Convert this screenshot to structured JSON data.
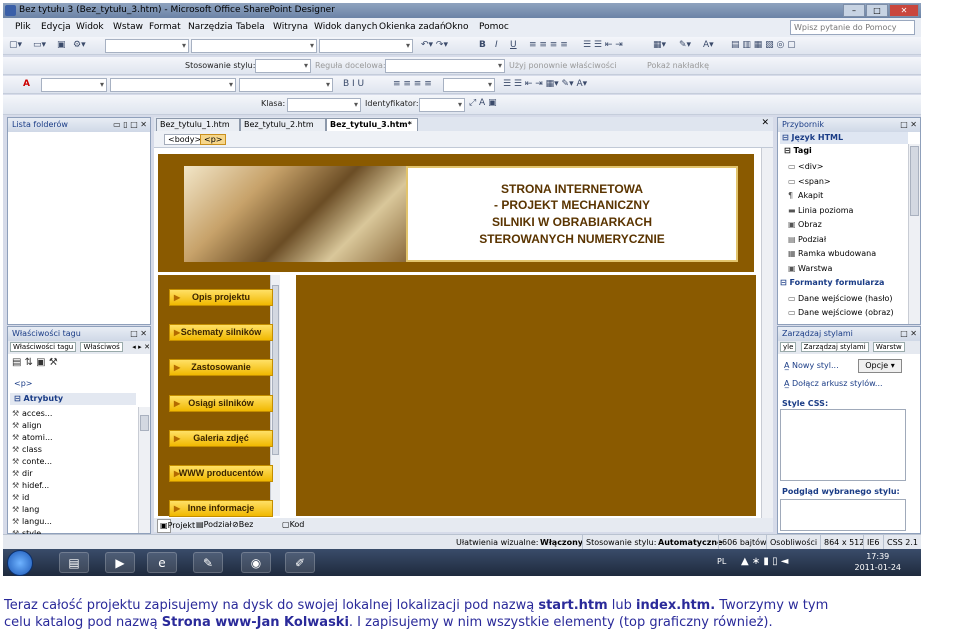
{
  "window": {
    "title": "Bez tytułu 3 (Bez_tytułu_3.htm) - Microsoft Office SharePoint Designer"
  },
  "menu": [
    "Plik",
    "Edycja",
    "Widok",
    "Wstaw",
    "Format",
    "Narzędzia",
    "Tabela",
    "Witryna",
    "Widok danych",
    "Okienka zadań",
    "Okno",
    "Pomoc"
  ],
  "help_placeholder": "Wpisz pytanie do Pomocy",
  "toolbar": {
    "style_apply_label": "Stosowanie stylu:",
    "target_rule_label": "Reguła docelowa:",
    "reuse_props_label": "Użyj ponownie właściwości",
    "show_overlay_label": "Pokaż nakładkę",
    "class_label": "Klasa:",
    "id_label": "Identyfikator:",
    "bold": "B",
    "italic": "I",
    "underline": "U"
  },
  "folder_list": {
    "title": "Lista folderów"
  },
  "tag_properties": {
    "title": "Właściwości tagu",
    "tabs": [
      "Właściwości tagu",
      "Właściwoś"
    ],
    "current_tag": "<p>",
    "group": "Atrybuty",
    "attributes": [
      "acces...",
      "align",
      "atomi...",
      "class",
      "conte...",
      "dir",
      "hidef...",
      "id",
      "lang",
      "langu...",
      "style"
    ]
  },
  "doc_tabs": [
    "Bez_tytulu_1.htm",
    "Bez_tytulu_2.htm",
    "Bez_tytulu_3.htm*"
  ],
  "quick_tags": [
    "<body>",
    "<p>"
  ],
  "page": {
    "banner_lines": [
      "STRONA INTERNETOWA",
      "- PROJEKT MECHANICZNY",
      "SILNIKI W OBRABIARKACH",
      "STEROWANYCH NUMERYCZNIE"
    ],
    "nav": [
      "Opis projektu",
      "Schematy silników",
      "Zastosowanie",
      "Osiągi silników",
      "Galeria zdjęć",
      "WWW producentów",
      "Inne informacje"
    ],
    "colors": {
      "brown": "#8a5a00",
      "button": "#f1b800"
    }
  },
  "view_tabs": [
    "Projekt",
    "Podział",
    "Bez ramek",
    "Kod"
  ],
  "toolbox": {
    "title": "Przybornik",
    "section_html": "Język HTML",
    "section_tags": "Tagi",
    "tags": [
      "<div>",
      "<span>",
      "Akapit",
      "Linia pozioma",
      "Obraz",
      "Podział",
      "Ramka wbudowana",
      "Warstwa"
    ],
    "section_forms": "Formanty formularza",
    "forms": [
      "Dane wejściowe (hasło)",
      "Dane wejściowe (obraz)"
    ]
  },
  "style_manager": {
    "title": "Zarządzaj stylami",
    "tabs": [
      "yle",
      "Zarządzaj stylami",
      "Warstw"
    ],
    "new_style": "Nowy styl...",
    "options": "Opcje",
    "attach_css": "Dołącz arkusz stylów...",
    "css_label": "Style CSS:",
    "preview_label": "Podgląd wybranego stylu:"
  },
  "status": {
    "visual_aids_label": "Ułatwienia wizualne:",
    "visual_aids": "Włączony",
    "style_apply_label": "Stosowanie stylu:",
    "style_apply": "Automatyczne",
    "size": "606 bajtów",
    "mode": "Osobliwości",
    "resolution": "864 x 512",
    "browser": "IE6",
    "css": "CSS 2.1"
  },
  "taskbar": {
    "lang": "PL",
    "time": "17:39",
    "date": "2011-01-24"
  },
  "caption": {
    "line1_pre": "Teraz całość projektu zapisujemy na dysk do swojej lokalnej lokalizacji pod nazwą ",
    "file1": "start.htm",
    "or": " lub ",
    "file2": "index.htm.",
    "line1_post": " Tworzymy w tym",
    "line2_pre": "celu katalog pod nazwą ",
    "folder": "Strona www-Jan Kolwaski",
    "line2_post": ". I zapisujemy w nim wszystkie elementy (top graficzny również)."
  }
}
